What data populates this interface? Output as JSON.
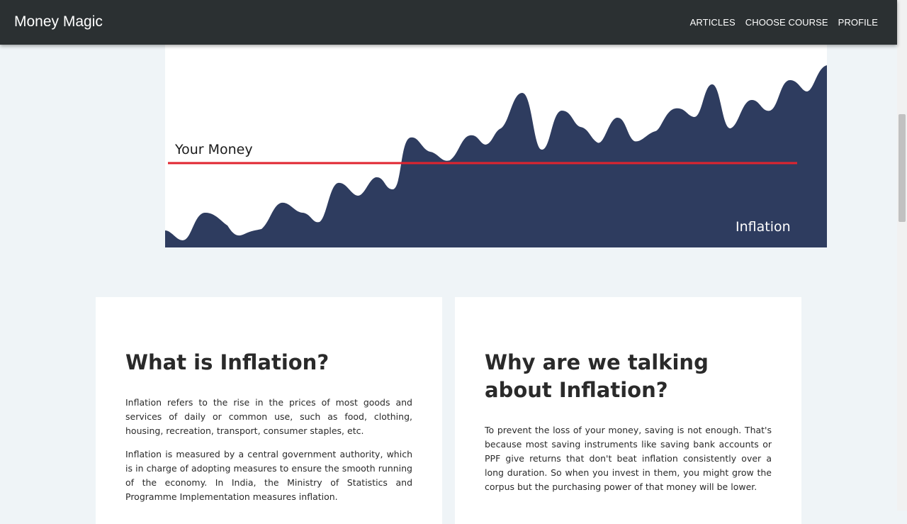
{
  "navbar": {
    "brand": "Money Magic",
    "links": [
      "ARTICLES",
      "CHOOSE COURSE",
      "PROFILE"
    ]
  },
  "hero": {
    "money_label": "Your Money",
    "inflation_label": "Inflation",
    "colors": {
      "area": "#2e3c5f",
      "money_line": "#e0242f"
    }
  },
  "cards": [
    {
      "title": "What is Inflation?",
      "paragraphs": [
        "Inflation refers to the rise in the prices of most goods and services of daily or common use, such as food, clothing, housing, recreation, transport, consumer staples, etc.",
        "Inflation is measured by a central government authority, which is in charge of adopting measures to ensure the smooth running of the economy. In India, the Ministry of Statistics and Programme Implementation measures inflation."
      ]
    },
    {
      "title": "Why are we talking about Inflation?",
      "paragraphs": [
        "To prevent the loss of your money, saving is not enough. That's because most saving instruments like saving bank accounts or PPF give returns that don't beat inflation consistently over a long duration. So when you invest in them, you might grow the corpus but the purchasing power of that money will be lower."
      ]
    }
  ]
}
